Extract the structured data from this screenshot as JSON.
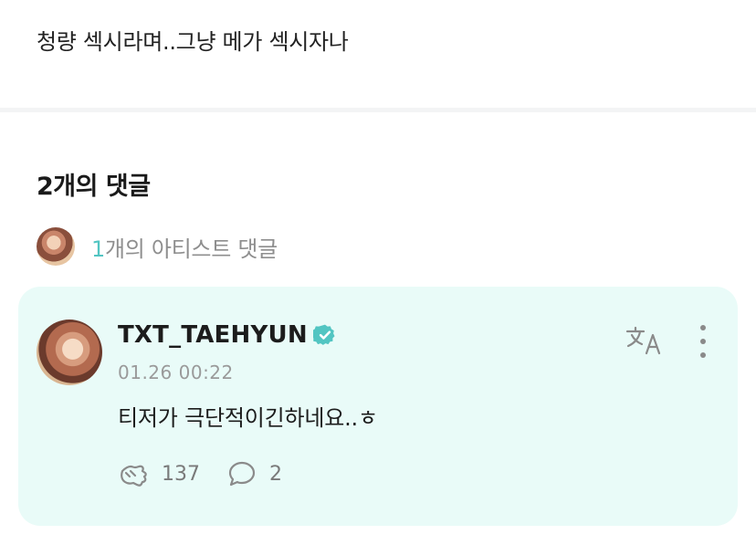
{
  "post": {
    "text": "청량 섹시라며..그냥 메가 섹시자나"
  },
  "comments_header": {
    "count_label": "2개의 댓글"
  },
  "artist_comments": {
    "count": "1",
    "label": "개의 아티스트 댓글"
  },
  "comment": {
    "username": "TXT_TAEHYUN",
    "timestamp": "01.26 00:22",
    "body": "티저가 극단적이긴하네요..ㅎ",
    "likes": "137",
    "replies": "2",
    "icons": [
      "verified-badge-icon",
      "translate-icon",
      "more-vertical-icon",
      "like-icon",
      "reply-icon"
    ],
    "colors": {
      "card_bg": "#e9fbf8",
      "accent": "#52c5c2",
      "verified": "#52c5c2"
    }
  }
}
